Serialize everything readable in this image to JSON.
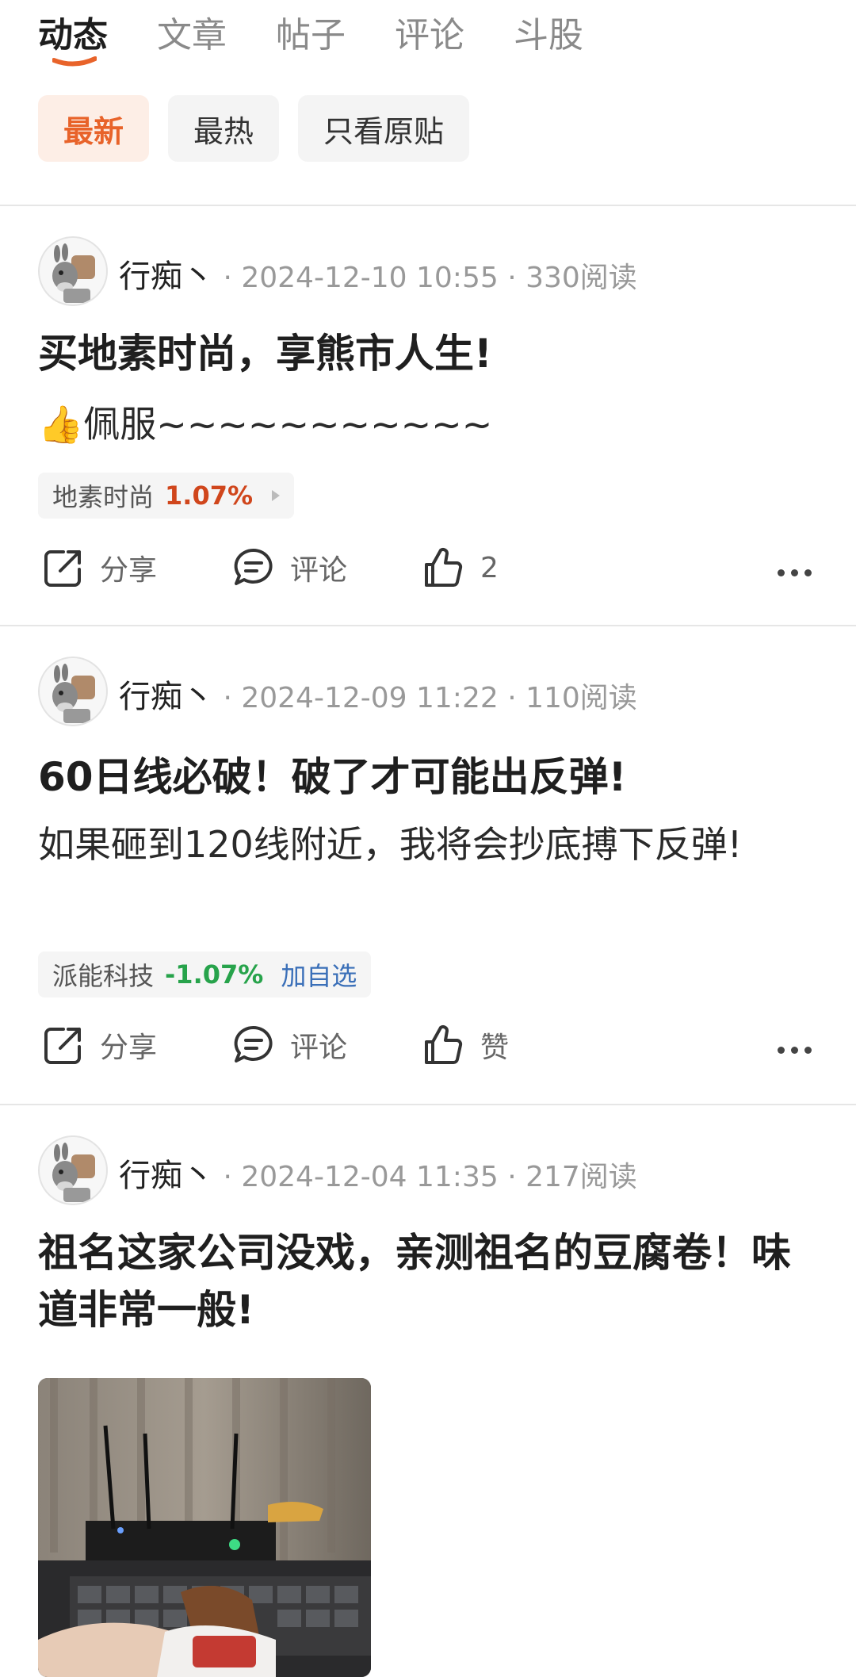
{
  "tabs": [
    {
      "label": "动态",
      "active": true
    },
    {
      "label": "文章"
    },
    {
      "label": "帖子"
    },
    {
      "label": "评论"
    },
    {
      "label": "斗股"
    }
  ],
  "filters": [
    {
      "label": "最新",
      "active": true
    },
    {
      "label": "最热"
    },
    {
      "label": "只看原贴"
    }
  ],
  "posts": [
    {
      "author": "行痴丶",
      "date": "2024-12-10 10:55",
      "reads": "330阅读",
      "title": "买地素时尚，享熊市人生!",
      "body": "佩服~~~~~~~~~~~",
      "emoji": "👍",
      "stock": {
        "name": "地素时尚",
        "change": "1.07%"
      },
      "actions": {
        "share": "分享",
        "comment": "评论",
        "like": "2"
      }
    },
    {
      "author": "行痴丶",
      "date": "2024-12-09 11:22",
      "reads": "110阅读",
      "title": "60日线必破！破了才可能出反弹!",
      "body": "如果砸到120线附近，我将会抄底搏下反弹!",
      "stock": {
        "name": "派能科技",
        "change": "-1.07%",
        "add": "加自选"
      },
      "actions": {
        "share": "分享",
        "comment": "评论",
        "like": "赞"
      }
    },
    {
      "author": "行痴丶",
      "date": "2024-12-04 11:35",
      "reads": "217阅读",
      "title": "祖名这家公司没戏，亲测祖名的豆腐卷！味道非常一般!"
    }
  ],
  "colors": {
    "accent": "#e8632a",
    "up": "#d0461c",
    "down": "#27a34b",
    "link": "#3a6fb8"
  }
}
